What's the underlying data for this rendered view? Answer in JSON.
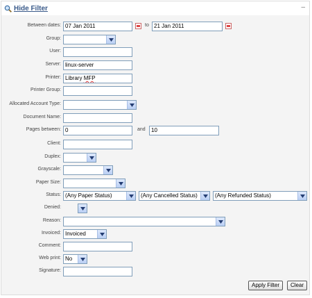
{
  "header": {
    "toggle_label": "Hide Filter",
    "collapse_glyph": "–"
  },
  "dates": {
    "label": "Between dates:",
    "from": "07 Jan 2011",
    "to_label": "to",
    "to": "21 Jan 2011"
  },
  "group": {
    "label": "Group:",
    "value": ""
  },
  "user": {
    "label": "User:",
    "value": ""
  },
  "server": {
    "label": "Server:",
    "value": "linux-server"
  },
  "printer": {
    "label": "Printer:",
    "value_prefix": "Library ",
    "value_spell": "MFP"
  },
  "printer_group": {
    "label": "Printer Group:",
    "value": ""
  },
  "allocated_account_type": {
    "label": "Allocated Account Type:",
    "value": ""
  },
  "document_name": {
    "label": "Document Name:",
    "value": ""
  },
  "pages": {
    "label": "Pages between:",
    "from": "0",
    "and_label": "and",
    "to": "10"
  },
  "client": {
    "label": "Client:",
    "value": ""
  },
  "duplex": {
    "label": "Duplex:",
    "value": ""
  },
  "grayscale": {
    "label": "Grayscale:",
    "value": ""
  },
  "paper_size": {
    "label": "Paper Size:",
    "value": ""
  },
  "status": {
    "label": "Status:",
    "paper": "(Any Paper Status)",
    "cancelled": "(Any Cancelled Status)",
    "refunded": "(Any Refunded Status)"
  },
  "denied": {
    "label": "Denied:",
    "value": ""
  },
  "reason": {
    "label": "Reason:",
    "value": ""
  },
  "invoiced": {
    "label": "Invoiced:",
    "value": "Invoiced"
  },
  "comment": {
    "label": "Comment:",
    "value": ""
  },
  "web_print": {
    "label": "Web print:",
    "value": "No"
  },
  "signature": {
    "label": "Signature:",
    "value": ""
  },
  "buttons": {
    "apply": "Apply Filter",
    "clear": "Clear"
  },
  "colors": {
    "link": "#3a5a8a",
    "input_border": "#7f9db9",
    "panel_bg": "#f4f4f4"
  },
  "icons": {
    "search": "magnifier-icon",
    "calendar": "calendar-icon",
    "dropdown": "chevron-down-icon"
  }
}
